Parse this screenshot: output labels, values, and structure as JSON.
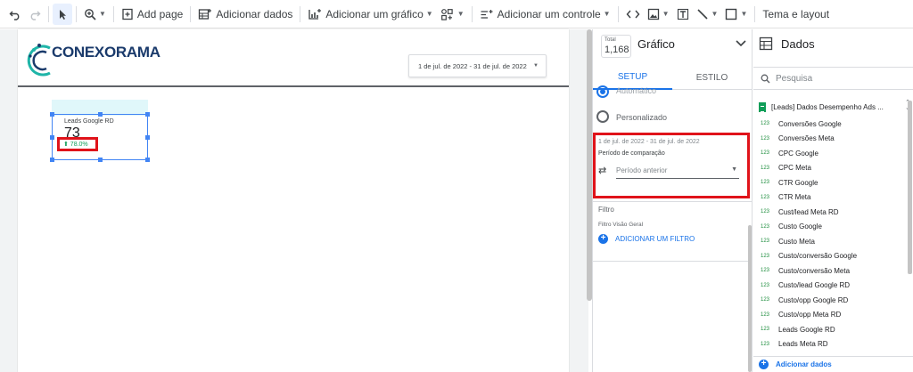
{
  "toolbar": {
    "add_page": "Add page",
    "add_data": "Adicionar dados",
    "add_chart": "Adicionar um gráfico",
    "add_control": "Adicionar um controle",
    "theme_layout": "Tema e layout"
  },
  "canvas": {
    "logo_text": "CONEXORAMA",
    "date_range": "1 de jul. de 2022 - 31 de jul. de 2022",
    "scorecard": {
      "label": "Leads Google RD",
      "value": "73",
      "delta": "⬆ 78.0%"
    }
  },
  "setup_panel": {
    "total_label": "Total",
    "total_value": "1,168",
    "chart_title": "Gráfico",
    "tabs": [
      "SETUP",
      "ESTILO"
    ],
    "radio_auto": "Automático",
    "radio_custom": "Personalizado",
    "comparison_date": "1 de jul. de 2022 - 31 de jul. de 2022",
    "comparison_title": "Período de comparação",
    "comparison_value": "Período anterior",
    "filter_heading": "Filtro",
    "filter_sub": "Filtro Visão Geral",
    "add_filter": "ADICIONAR UM FILTRO"
  },
  "data_panel": {
    "title": "Dados",
    "search_placeholder": "Pesquisa",
    "source_name": "[Leads] Dados Desempenho Ads ...",
    "field_tag": "123",
    "fields": [
      "Conversões Google",
      "Conversões Meta",
      "CPC Google",
      "CPC Meta",
      "CTR Google",
      "CTR Meta",
      "Cust/lead Meta RD",
      "Custo Google",
      "Custo Meta",
      "Custo/conversão Google",
      "Custo/conversão Meta",
      "Custo/lead Google RD",
      "Custo/opp Google RD",
      "Custo/opp Meta RD",
      "Leads Google RD",
      "Leads Meta RD"
    ],
    "add_data": "Adicionar dados"
  },
  "colors": {
    "accent": "#1a73e8",
    "highlight_red": "#e0131a",
    "positive_green": "#0f9d58",
    "logo_navy": "#1a3a6b",
    "logo_teal": "#1fb5a8"
  }
}
